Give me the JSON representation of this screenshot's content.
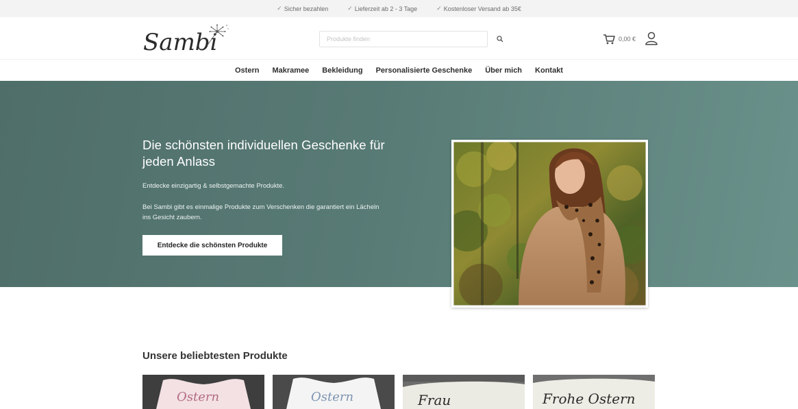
{
  "topbar": {
    "items": [
      "Sicher bezahlen",
      "Lieferzeit ab 2 - 3 Tage",
      "Kostenloser Versand ab 35€"
    ]
  },
  "header": {
    "logo_text": "Sambi",
    "search_placeholder": "Produkte finden",
    "cart_total": "0,00 €"
  },
  "nav": {
    "items": [
      "Ostern",
      "Makramee",
      "Bekleidung",
      "Personalisierte Geschenke",
      "Über mich",
      "Kontakt"
    ]
  },
  "hero": {
    "title": "Die schönsten individuellen Geschenke für jeden Anlass",
    "p1": "Entdecke einzigartig & selbstgemachte Produkte.",
    "p2": "Bei Sambi gibt es einmalige Produkte zum Verschenken die garantiert ein Lächeln ins Gesicht zaubern.",
    "cta": "Entdecke die schönsten Produkte"
  },
  "products_section": {
    "title": "Unsere beliebtesten Produkte",
    "items": [
      {
        "label": "Ostern"
      },
      {
        "label": "Ostern"
      },
      {
        "label": "Frau"
      },
      {
        "label": "Frohe Ostern"
      }
    ]
  },
  "colors": {
    "hero_bg": "#587a75",
    "accent": "#ffffff"
  }
}
